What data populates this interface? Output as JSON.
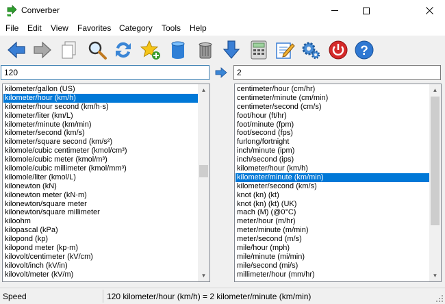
{
  "window": {
    "title": "Converber"
  },
  "menu": [
    "File",
    "Edit",
    "View",
    "Favorites",
    "Category",
    "Tools",
    "Help"
  ],
  "toolbar": [
    {
      "icon": "back-arrow-icon"
    },
    {
      "icon": "forward-arrow-icon"
    },
    {
      "icon": "copy-icon"
    },
    {
      "icon": "search-icon"
    },
    {
      "icon": "swap-icon"
    },
    {
      "icon": "add-favorite-star-icon"
    },
    {
      "icon": "database-icon"
    },
    {
      "icon": "trash-can-icon"
    },
    {
      "icon": "download-arrow-icon"
    },
    {
      "icon": "calculator-icon"
    },
    {
      "icon": "edit-notepad-icon"
    },
    {
      "icon": "settings-gears-icon"
    },
    {
      "icon": "power-icon"
    },
    {
      "icon": "help-icon"
    }
  ],
  "input_left": {
    "value": "120"
  },
  "input_right": {
    "value": "2"
  },
  "left_list": {
    "items": [
      "kilometer/gallon (US)",
      "kilometer/hour (km/h)",
      "kilometer/hour second (km/h·s)",
      "kilometer/liter (km/L)",
      "kilometer/minute (km/min)",
      "kilometer/second (km/s)",
      "kilometer/square second (km/s²)",
      "kilomole/cubic centimeter (kmol/cm³)",
      "kilomole/cubic meter (kmol/m³)",
      "kilomole/cubic millimeter (kmol/mm³)",
      "kilomole/liter (kmol/L)",
      "kilonewton (kN)",
      "kilonewton meter (kN·m)",
      "kilonewton/square meter",
      "kilonewton/square millimeter",
      "kiloohm",
      "kilopascal (kPa)",
      "kilopond (kp)",
      "kilopond meter (kp·m)",
      "kilovolt/centimeter (kV/cm)",
      "kilovolt/inch (kV/in)",
      "kilovolt/meter (kV/m)"
    ],
    "selected_index": 1
  },
  "right_list": {
    "items": [
      "centimeter/hour (cm/hr)",
      "centimeter/minute (cm/min)",
      "centimeter/second (cm/s)",
      "foot/hour (ft/hr)",
      "foot/minute (fpm)",
      "foot/second (fps)",
      "furlong/fortnight",
      "inch/minute (ipm)",
      "inch/second (ips)",
      "kilometer/hour (km/h)",
      "kilometer/minute (km/min)",
      "kilometer/second (km/s)",
      "knot (kn) (kt)",
      "knot (kn) (kt) (UK)",
      "mach (M) (@0°C)",
      "meter/hour (m/hr)",
      "meter/minute (m/min)",
      "meter/second (m/s)",
      "mile/hour (mph)",
      "mile/minute (mi/min)",
      "mile/second (mi/s)",
      "millimeter/hour (mm/hr)"
    ],
    "selected_index": 10
  },
  "status": {
    "category": "Speed",
    "result": "120 kilometer/hour (km/h) = 2 kilometer/minute (km/min)"
  },
  "colors": {
    "selection": "#0078d7",
    "input_focus_border": "#3c7fb1"
  }
}
